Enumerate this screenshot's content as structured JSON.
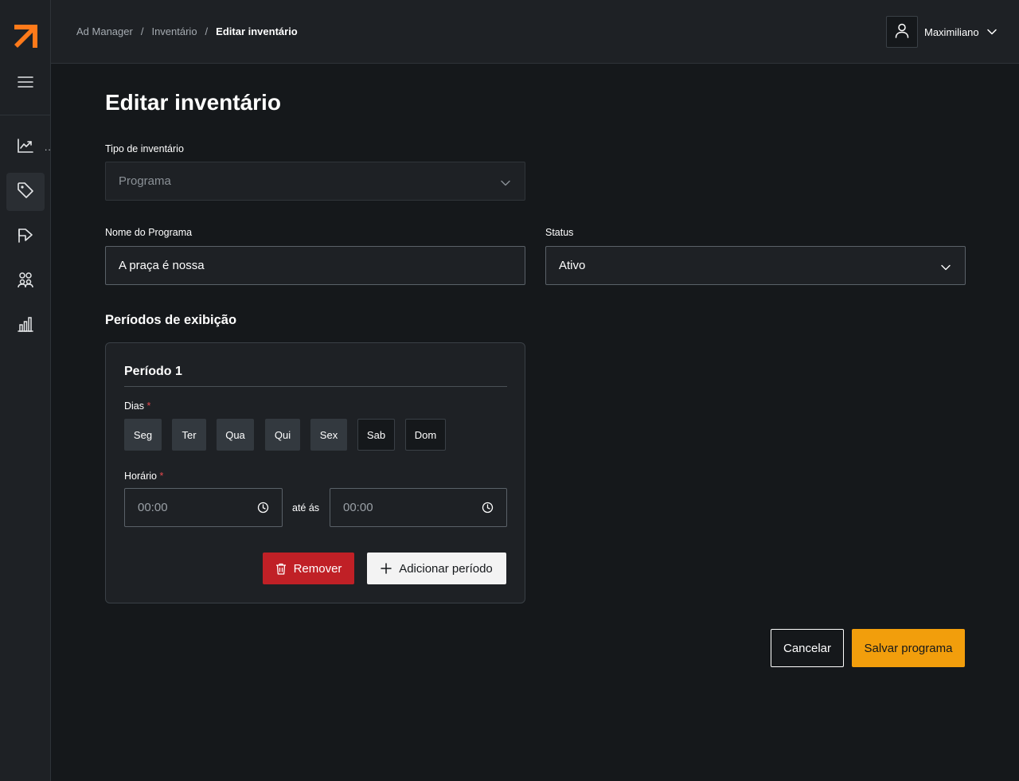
{
  "brand": {
    "accent": "#ff7a1a",
    "primary": "#f29e0c",
    "danger": "#c02026"
  },
  "sidebar": {
    "menu_icon": "hamburger-icon",
    "items": [
      {
        "icon": "trend-chart-icon",
        "active": false
      },
      {
        "icon": "tag-icon",
        "active": true
      },
      {
        "icon": "megaphone-icon",
        "active": false
      },
      {
        "icon": "users-icon",
        "active": false
      },
      {
        "icon": "bar-chart-icon",
        "active": false
      }
    ],
    "overflow_text": ".."
  },
  "header": {
    "breadcrumb": [
      "Ad Manager",
      "Inventário",
      "Editar inventário"
    ],
    "breadcrumb_separator": "/",
    "user_name": "Maximiliano"
  },
  "page": {
    "title": "Editar inventário"
  },
  "form": {
    "tipo_label": "Tipo de inventário",
    "tipo_value": "Programa",
    "nome_label": "Nome do Programa",
    "nome_value": "A praça é nossa",
    "status_label": "Status",
    "status_value": "Ativo"
  },
  "periods": {
    "section_title": "Períodos de exibição",
    "items": [
      {
        "title": "Período 1",
        "days_label": "Dias",
        "required_mark": "*",
        "days": [
          {
            "label": "Seg",
            "selected": true
          },
          {
            "label": "Ter",
            "selected": true
          },
          {
            "label": "Qua",
            "selected": true
          },
          {
            "label": "Qui",
            "selected": true
          },
          {
            "label": "Sex",
            "selected": true
          },
          {
            "label": "Sab",
            "selected": false
          },
          {
            "label": "Dom",
            "selected": false
          }
        ],
        "time_label": "Horário",
        "time_start": "00:00",
        "time_connector": "até ás",
        "time_end": "00:00",
        "remove_label": "Remover",
        "add_label": "Adicionar período"
      }
    ]
  },
  "actions": {
    "cancel_label": "Cancelar",
    "save_label": "Salvar programa"
  }
}
